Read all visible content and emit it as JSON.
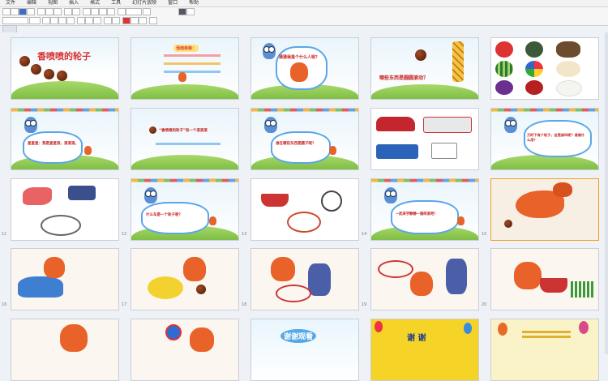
{
  "menu": [
    "文件",
    "编辑",
    "视图",
    "插入",
    "格式",
    "工具",
    "幻灯片放映",
    "窗口",
    "帮助"
  ],
  "slides": [
    {
      "id": 1,
      "number": "",
      "title": "香喷喷的轮子",
      "kind": "cover"
    },
    {
      "id": 2,
      "number": "",
      "title": "活动目标：",
      "kind": "goals"
    },
    {
      "id": 3,
      "number": "",
      "title": "猜猜我是个什么人呢？",
      "kind": "owl-squirrel"
    },
    {
      "id": 4,
      "number": "",
      "title": "哪些东西是圆圆滚动？",
      "kind": "giraffe"
    },
    {
      "id": 5,
      "number": "",
      "title": "",
      "kind": "fruits"
    },
    {
      "id": 6,
      "number": "",
      "title": "星星星：我是星星滚，滚滚滚。",
      "kind": "owl-cloud"
    },
    {
      "id": 7,
      "number": "",
      "title": "“香喷喷的轮子”有一个滚滚滚",
      "kind": "owl-cloud2"
    },
    {
      "id": 8,
      "number": "",
      "title": "谁在哪些东西是圆子呢？",
      "kind": "owl-cloud"
    },
    {
      "id": 9,
      "number": "",
      "title": "",
      "kind": "vehicles"
    },
    {
      "id": 10,
      "number": "",
      "title": "万时下有个轮子，这是谁叫呢？谁做什么用？",
      "kind": "owl-cloud"
    },
    {
      "id": 11,
      "number": "11",
      "title": "",
      "kind": "bikes"
    },
    {
      "id": 12,
      "number": "12",
      "title": "什么车是一个轮子呢？",
      "kind": "owl-cloud"
    },
    {
      "id": 13,
      "number": "13",
      "title": "",
      "kind": "wheelbarrow"
    },
    {
      "id": 14,
      "number": "14",
      "title": "一起来学静静一路呀滚吧！",
      "kind": "owl-cloud"
    },
    {
      "id": 15,
      "number": "15",
      "title": "",
      "kind": "squirrel-draw"
    },
    {
      "id": 16,
      "number": "16",
      "title": "",
      "kind": "car-draw"
    },
    {
      "id": 17,
      "number": "17",
      "title": "",
      "kind": "duck-draw"
    },
    {
      "id": 18,
      "number": "18",
      "title": "",
      "kind": "grandpa-draw"
    },
    {
      "id": 19,
      "number": "19",
      "title": "",
      "kind": "grandpa-draw2"
    },
    {
      "id": 20,
      "number": "20",
      "title": "",
      "kind": "cart-draw"
    },
    {
      "id": 21,
      "number": "",
      "title": "",
      "kind": "squirrel-draw2"
    },
    {
      "id": 22,
      "number": "",
      "title": "",
      "kind": "sign-draw"
    },
    {
      "id": 23,
      "number": "",
      "title": "谢谢观看",
      "kind": "thanks-blue"
    },
    {
      "id": 24,
      "number": "",
      "title": "谢 谢",
      "kind": "thanks-yellow"
    },
    {
      "id": 25,
      "number": "",
      "title": "",
      "kind": "balloons"
    }
  ],
  "colors": {
    "accent": "#f0a020",
    "slide_border": "#c9ced8",
    "title_red": "#d72e2e"
  }
}
